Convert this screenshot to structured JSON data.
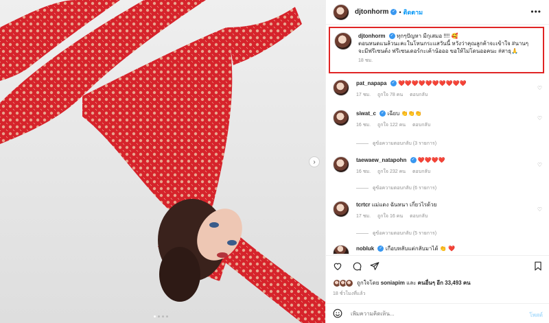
{
  "post": {
    "username": "djtonhorm",
    "follow_label": "ติดตาม",
    "caption_lines": [
      "ทุกๆปัญหา มีกุเสมอ !!!! 🥰",
      "ตอนหนดแนล้วนะคะในโหนกระแสวันนี้ หวังว่าคุณลูกค้าจะเข้าใจ #นานๆ",
      "จะมีฟรีเซนต์ง ฟรีเซนเดอร์กะเค้าน้อออ ขอให้ไม่โดนออคนะ #สาธุ🙏"
    ],
    "caption_time": "18 ชม."
  },
  "comments": [
    {
      "username": "pat_napapa",
      "text": "❤️❤️❤️❤️❤️❤️❤️❤️❤️❤️",
      "time": "17 ชม.",
      "likes": "ถูกใจ 78 คน",
      "reply": "ตอบกลับ",
      "view_replies": ""
    },
    {
      "username": "siwat_c",
      "text": "เฉียบ 👏👏👏",
      "time": "16 ชม.",
      "likes": "ถูกใจ 122 คน",
      "reply": "ตอบกลับ",
      "view_replies": "ดูข้อความตอบกลับ (3 รายการ)"
    },
    {
      "username": "taewaew_natapohn",
      "text": "❤️❤️❤️❤️",
      "time": "16 ชม.",
      "likes": "ถูกใจ 232 คน",
      "reply": "ตอบกลับ",
      "view_replies": "ดูข้อความตอบกลับ (6 รายการ)"
    },
    {
      "username": "tcrtcr",
      "text": "แม่แดง ฉันหนา เกี่ยวไรด้วย",
      "time": "17 ชม.",
      "likes": "ถูกใจ 16 คน",
      "reply": "ตอบกลับ",
      "view_replies": "ดูข้อความตอบกลับ (5 รายการ)"
    },
    {
      "username": "nobluk",
      "text": "เกือบหลับแต่กลับมาได้ 👏 ❤️",
      "time": "",
      "likes": "",
      "reply": "",
      "view_replies": ""
    }
  ],
  "footer": {
    "liked_by_prefix": "ถูกใจโดย",
    "liked_by_user": "soniapim",
    "liked_by_and": "และ",
    "liked_by_others": "คนอื่นๆ อีก 33,493 คน",
    "post_time": "18 ชั่วโมงที่แล้ว",
    "comment_placeholder": "เพิ่มความคิดเห็น...",
    "post_label": "โพสต์"
  },
  "colors": {
    "accent": "#0095f6",
    "verified": "#3897f0",
    "highlight_border": "#e02424",
    "heart": "#ed4956",
    "dress": "#d6232b"
  },
  "icons": [
    "more-icon",
    "heart-icon",
    "comment-icon",
    "share-icon",
    "bookmark-icon",
    "emoji-icon",
    "chevron-right-icon",
    "verified-icon"
  ]
}
